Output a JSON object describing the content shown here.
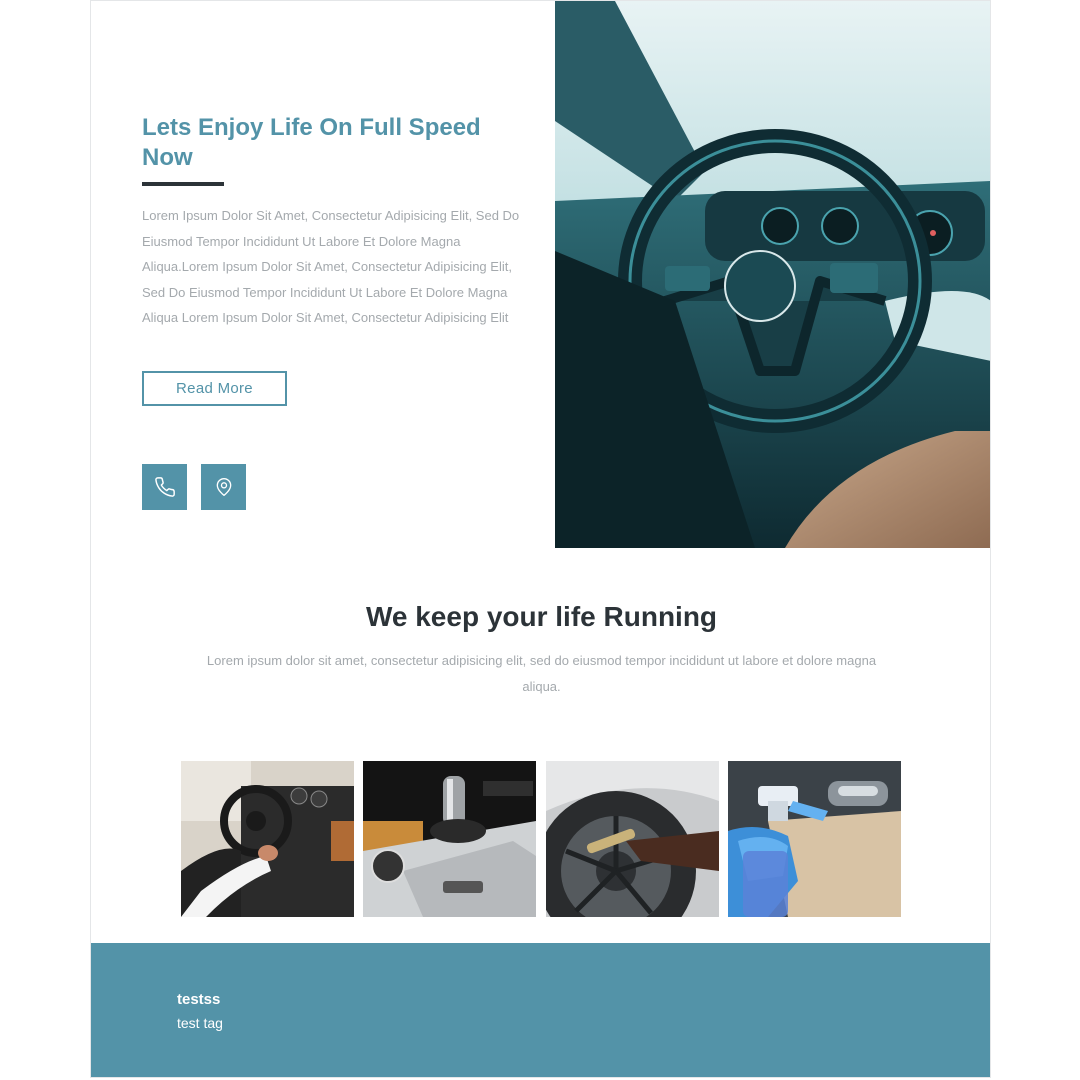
{
  "hero": {
    "title": "Lets Enjoy Life On Full Speed Now",
    "body": "Lorem Ipsum Dolor Sit Amet, Consectetur Adipisicing Elit, Sed Do Eiusmod Tempor Incididunt Ut Labore Et Dolore Magna Aliqua.Lorem Ipsum Dolor Sit Amet, Consectetur Adipisicing Elit, Sed Do Eiusmod Tempor Incididunt Ut Labore Et Dolore Magna Aliqua Lorem Ipsum Dolor Sit Amet, Consectetur Adipisicing Elit",
    "button_label": "Read More",
    "contact_icons": [
      "phone-icon",
      "location-pin-icon"
    ],
    "image": "car-steering-wheel-interior"
  },
  "services": {
    "title": "We keep your life Running",
    "body": "Lorem ipsum dolor sit amet, consectetur adipisicing elit, sed do eiusmod tempor incididunt ut labore et dolore magna aliqua.",
    "gallery": [
      "driver-steering-wheel",
      "gear-shifter-console",
      "wheel-rim-cleaning",
      "door-interior-spray-cleaning"
    ]
  },
  "footer": {
    "title": "testss",
    "tag": "test tag"
  },
  "colors": {
    "accent": "#5393a8",
    "heading": "#2c3338",
    "body_text": "#a4a9ad",
    "footer_bg": "#5393a8"
  }
}
